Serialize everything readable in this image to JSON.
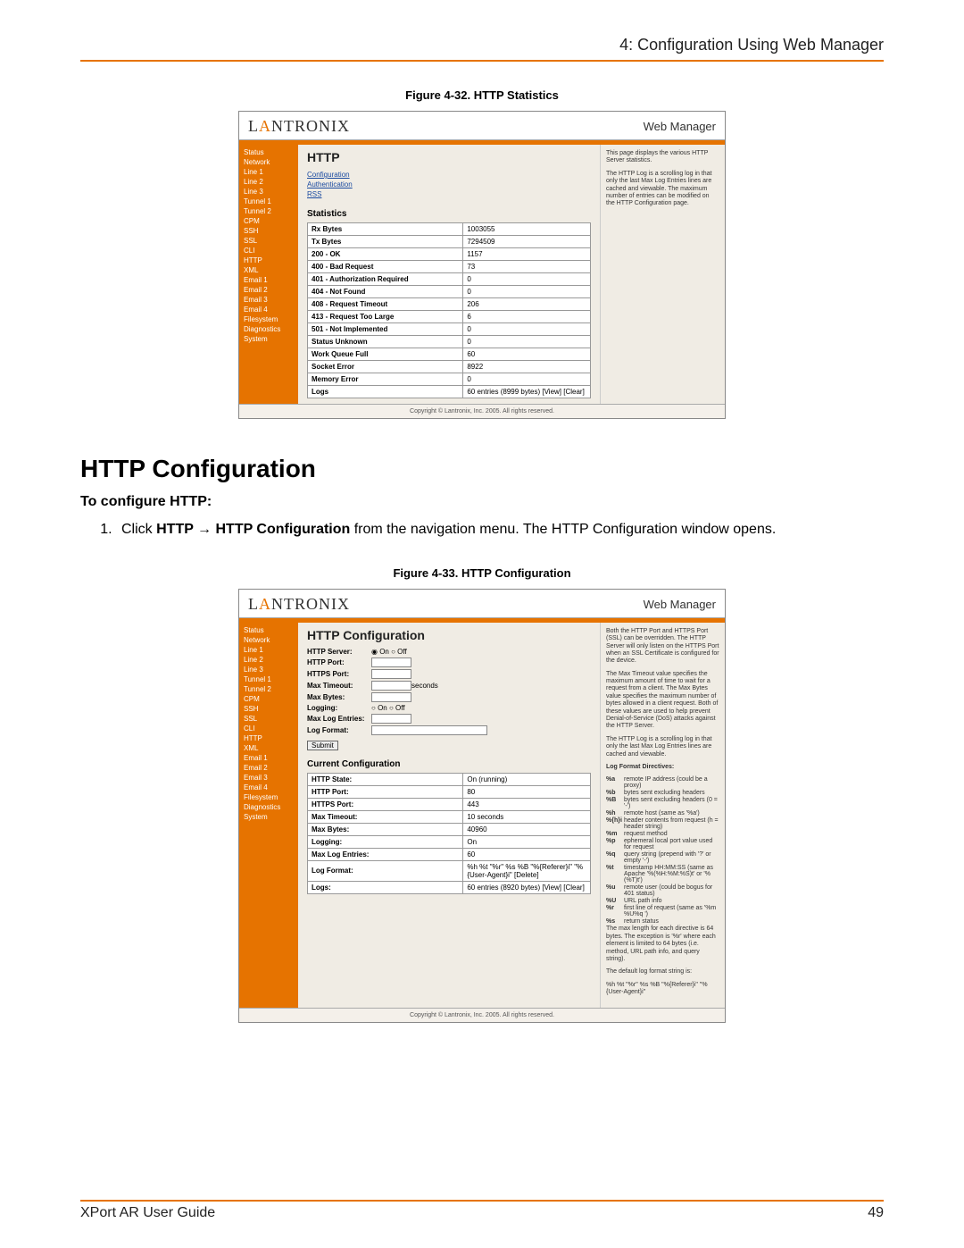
{
  "header": {
    "chapter": "4: Configuration Using Web Manager"
  },
  "fig1": {
    "caption": "Figure 4-32. HTTP Statistics",
    "logo_l": "L",
    "logo_a": "A",
    "logo_rest": "NTRONIX",
    "web_manager": "Web Manager",
    "side": [
      "Status",
      "Network",
      "Line 1",
      "Line 2",
      "Line 3",
      "Tunnel 1",
      "Tunnel 2",
      "CPM",
      "SSH",
      "SSL",
      "CLI",
      "HTTP",
      "XML",
      "Email 1",
      "Email 2",
      "Email 3",
      "Email 4",
      "Filesystem",
      "Diagnostics",
      "System"
    ],
    "h1": "HTTP",
    "sublinks": [
      "Configuration",
      "Authentication",
      "RSS"
    ],
    "h2": "Statistics",
    "rows": [
      [
        "Rx Bytes",
        "1003055"
      ],
      [
        "Tx Bytes",
        "7294509"
      ],
      [
        "200 - OK",
        "1157"
      ],
      [
        "400 - Bad Request",
        "73"
      ],
      [
        "401 - Authorization Required",
        "0"
      ],
      [
        "404 - Not Found",
        "0"
      ],
      [
        "408 - Request Timeout",
        "206"
      ],
      [
        "413 - Request Too Large",
        "6"
      ],
      [
        "501 - Not Implemented",
        "0"
      ],
      [
        "Status Unknown",
        "0"
      ],
      [
        "Work Queue Full",
        "60"
      ],
      [
        "Socket Error",
        "8922"
      ],
      [
        "Memory Error",
        "0"
      ],
      [
        "Logs",
        "60 entries (8999 bytes) [View] [Clear]"
      ]
    ],
    "right": [
      "This page displays the various HTTP Server statistics.",
      "The HTTP Log is a scrolling log in that only the last Max Log Entries lines are cached and viewable. The maximum number of entries can be modified on the HTTP Configuration page."
    ],
    "copyright": "Copyright © Lantronix, Inc. 2005. All rights reserved."
  },
  "section": {
    "h1": "HTTP Configuration",
    "h2": "To configure HTTP:",
    "step1_pre": "Click ",
    "step1_b": "HTTP → HTTP Configuration",
    "step1_post": " from the navigation menu. The HTTP Configuration window opens."
  },
  "fig2": {
    "caption": "Figure 4-33. HTTP Configuration",
    "h1": "HTTP Configuration",
    "form": {
      "server_lbl": "HTTP Server:",
      "on": "On",
      "off": "Off",
      "port_lbl": "HTTP Port:",
      "sport_lbl": "HTTPS Port:",
      "timeout_lbl": "Max Timeout:",
      "seconds": "seconds",
      "bytes_lbl": "Max Bytes:",
      "logging_lbl": "Logging:",
      "maxlog_lbl": "Max Log Entries:",
      "logfmt_lbl": "Log Format:",
      "submit": "Submit"
    },
    "h2": "Current Configuration",
    "curr": [
      [
        "HTTP State:",
        "On (running)"
      ],
      [
        "HTTP Port:",
        "80"
      ],
      [
        "HTTPS Port:",
        "443"
      ],
      [
        "Max Timeout:",
        "10 seconds"
      ],
      [
        "Max Bytes:",
        "40960"
      ],
      [
        "Logging:",
        "On"
      ],
      [
        "Max Log Entries:",
        "60"
      ],
      [
        "Log Format:",
        "%h %t \"%r\" %s %B \"%{Referer}i\" \"%{User-Agent}i\" [Delete]"
      ],
      [
        "Logs:",
        "60 entries (8920 bytes) [View] [Clear]"
      ]
    ],
    "rightA": "Both the HTTP Port and HTTPS Port (SSL) can be overridden. The HTTP Server will only listen on the HTTPS Port when an SSL Certificate is configured for the device.",
    "rightB": "The Max Timeout value specifies the maximum amount of time to wait for a request from a client. The Max Bytes value specifies the maximum number of bytes allowed in a client request. Both of these values are used to help prevent Denial-of-Service (DoS) attacks against the HTTP Server.",
    "rightC": "The HTTP Log is a scrolling log in that only the last Max Log Entries lines are cached and viewable.",
    "dir_h": "Log Format Directives:",
    "dirs": [
      [
        "%a",
        "remote IP address (could be a proxy)"
      ],
      [
        "%b",
        "bytes sent excluding headers"
      ],
      [
        "%B",
        "bytes sent excluding headers (0 = '-')"
      ],
      [
        "%h",
        "remote host (same as '%a')"
      ],
      [
        "%{h}i",
        "header contents from request (h = header string)"
      ],
      [
        "%m",
        "request method"
      ],
      [
        "%p",
        "ephemeral local port value used for request"
      ],
      [
        "%q",
        "query string (prepend with '?' or empty '-')"
      ],
      [
        "%t",
        "timestamp HH:MM:SS (same as Apache '%(%H:%M:%S)t' or '%(%T)t')"
      ],
      [
        "%u",
        "remote user (could be bogus for 401 status)"
      ],
      [
        "%U",
        "URL path info"
      ],
      [
        "%r",
        "first line of request (same as '%m %U%q <version>')"
      ],
      [
        "%s",
        "return status"
      ]
    ],
    "rightD": "The max length for each directive is 64 bytes. The exception is '%r' where each element is limited to 64 bytes (i.e. method, URL path info, and query string).",
    "rightE": "The default log format string is:",
    "rightF": "%h %t \"%r\" %s %B \"%{Referer}i\" \"%{User-Agent}i\""
  },
  "footer": {
    "left": "XPort AR User Guide",
    "right": "49"
  }
}
